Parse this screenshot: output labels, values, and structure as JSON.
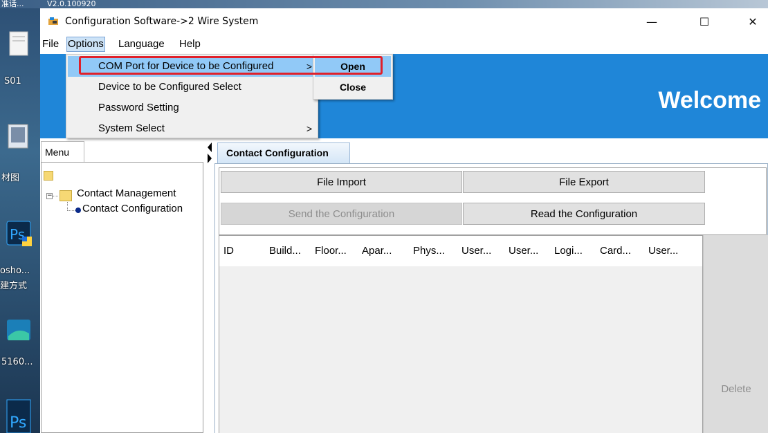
{
  "desktop": {
    "top_text_left": "准话...",
    "top_text_mid": "V2.0.100920",
    "labels": [
      "S01",
      "材图",
      "osho...",
      "建方式",
      "5160..."
    ]
  },
  "window": {
    "title": "Configuration Software->2 Wire System",
    "minimize": "—",
    "maximize": "☐",
    "close": "✕"
  },
  "menubar": {
    "items": [
      "File",
      "Options",
      "Language",
      "Help"
    ]
  },
  "banner": {
    "welcome": "Welcome"
  },
  "options_menu": {
    "items": [
      {
        "label": "COM Port for Device to be Configured",
        "arrow": ">"
      },
      {
        "label": "Device to be Configured Select",
        "arrow": ""
      },
      {
        "label": "Password Setting",
        "arrow": ""
      },
      {
        "label": "System Select",
        "arrow": ">"
      }
    ]
  },
  "com_submenu": {
    "items": [
      "Open",
      "Close"
    ]
  },
  "left_panel": {
    "tab": "Menu",
    "tree": {
      "group": "Contact Management",
      "child": "Contact Configuration"
    }
  },
  "right_panel": {
    "tab": "Contact Configuration",
    "buttons": {
      "file_import": "File Import",
      "file_export": "File Export",
      "send_config": "Send the Configuration",
      "read_config": "Read the Configuration"
    },
    "table_columns": [
      "ID",
      "Build...",
      "Floor...",
      "Apar...",
      "Phys...",
      "User...",
      "User...",
      "Logi...",
      "Card...",
      "User..."
    ],
    "delete_button": "Delete"
  },
  "colors": {
    "banner": "#1f86d8",
    "highlight": "#91c9f7",
    "callout": "#e0202a"
  }
}
